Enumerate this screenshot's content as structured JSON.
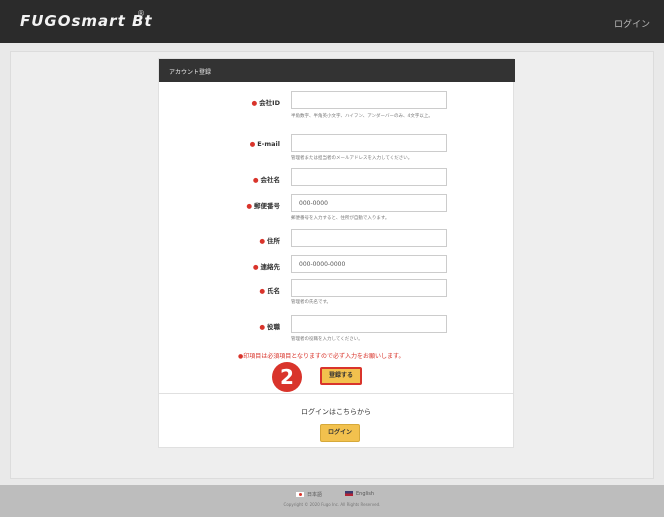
{
  "navbar": {
    "logo": "FUGOsmart Bt",
    "logo_mark": "®",
    "login_link": "ログイン"
  },
  "card": {
    "title": "アカウント登録",
    "fields": [
      {
        "label": "会社ID",
        "required": true,
        "value": "",
        "hint": "半角数字、半角英小文字、ハイフン、アンダーバーのみ、4文字以上。"
      },
      {
        "label": "E-mail",
        "required": true,
        "value": "",
        "hint": "管理者または担当者のメールアドレスを入力してください。"
      },
      {
        "label": "会社名",
        "required": true,
        "value": "",
        "hint": ""
      },
      {
        "label": "郵便番号",
        "required": true,
        "value": "000-0000",
        "hint": "郵便番号を入力すると、住所が自動で入ります。"
      },
      {
        "label": "住所",
        "required": true,
        "value": "",
        "hint": ""
      },
      {
        "label": "連絡先",
        "required": true,
        "value": "000-0000-0000",
        "hint": ""
      },
      {
        "label": "氏名",
        "required": true,
        "value": "",
        "hint": "管理者の氏名です。"
      },
      {
        "label": "役職",
        "required": true,
        "value": "",
        "hint": "管理者の役職を入力してください。"
      }
    ],
    "required_marker": "●",
    "required_note": "●印項目は必須項目となりますので必ず入力をお願いします。",
    "register_button": "登録する",
    "step_number": "2",
    "login_prompt": "ログインはこちらから",
    "login_button": "ログイン"
  },
  "footer": {
    "lang_ja": "日本語",
    "lang_en": "English",
    "copyright": "Copyright © 2020 Fugo Inc. All Rights Reserved."
  },
  "colors": {
    "navbar_bg": "#2b2b2b",
    "accent_yellow": "#f2c14e",
    "required_red": "#d9342b",
    "footer_bg": "#bdbdbd"
  }
}
